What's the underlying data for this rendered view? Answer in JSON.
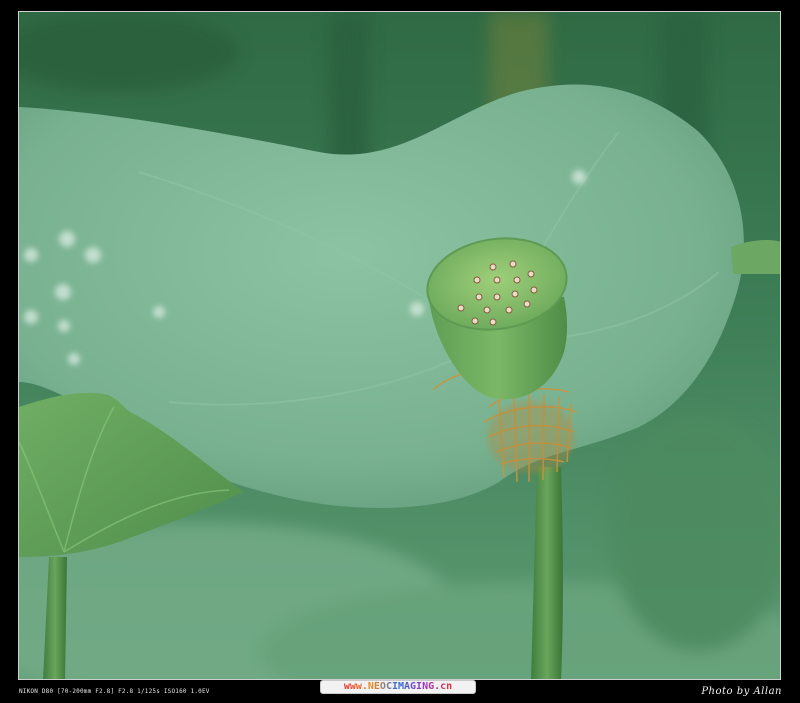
{
  "photo": {
    "subject": "lotus-seed-pod-photo"
  },
  "footer": {
    "exif": "NIKON D80 [70-200mm F2.8] F2.8 1/125s ISO160 1.0EV",
    "website": "www.NEOCIMAGING.cn",
    "credit": "Photo by Allan"
  },
  "colors": {
    "frame": "#000000",
    "leaf": "#7fb897",
    "background_green": "#3f7d55",
    "pod": "#7fb860",
    "stamens": "#c79a4a"
  }
}
